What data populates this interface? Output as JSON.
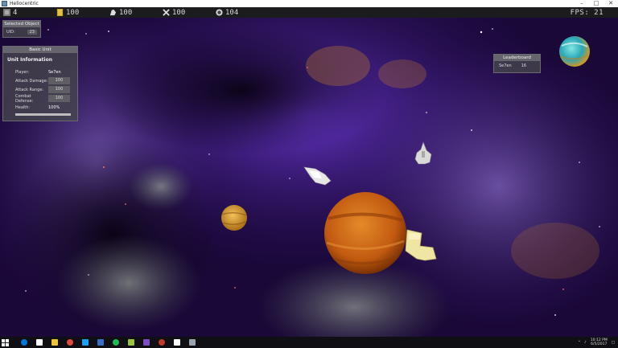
{
  "window": {
    "title": "Heliocentric",
    "minimize": "–",
    "maximize": "□",
    "close": "✕"
  },
  "resources": [
    {
      "icon": "population-icon",
      "value": "4",
      "color": "#8a8a8a"
    },
    {
      "icon": "gold-icon",
      "value": "100",
      "color": "#c9a227"
    },
    {
      "icon": "ore-icon",
      "value": "100",
      "color": "#d0d0d0"
    },
    {
      "icon": "tools-icon",
      "value": "100",
      "color": "#d0d0d0"
    },
    {
      "icon": "energy-icon",
      "value": "104",
      "color": "#d0d0d0"
    }
  ],
  "fps": "FPS: 21",
  "selected_object": {
    "header": "Selected Object",
    "uid_label": "UID:",
    "uid_value": "23"
  },
  "unit_panel": {
    "header": "Basic Unit",
    "section": "Unit Information",
    "player_label": "Player:",
    "player_value": "Se7en",
    "attack_damage_label": "Attack Damage:",
    "attack_damage_value": "100",
    "attack_range_label": "Attack Range:",
    "attack_range_value": "100",
    "combat_defense_label": "Combat Defense:",
    "combat_defense_value": "100",
    "health_label": "Health:",
    "health_value": "100%",
    "health_fraction": 1.0
  },
  "leaderboard": {
    "header": "Leaderboard",
    "entries": [
      {
        "name": "Se7en",
        "score": "16"
      }
    ]
  },
  "taskbar": {
    "time": "10:12 PM",
    "date": "6/5/2017",
    "apps": [
      "#0078d7",
      "#ffffff",
      "#f0c330",
      "#e04a3f",
      "#1ea1f2",
      "#3b6ec8",
      "#1db954",
      "#9ac33c",
      "#7b4cc4",
      "#c0392b",
      "#ffffff",
      "#9aa4b0"
    ]
  }
}
